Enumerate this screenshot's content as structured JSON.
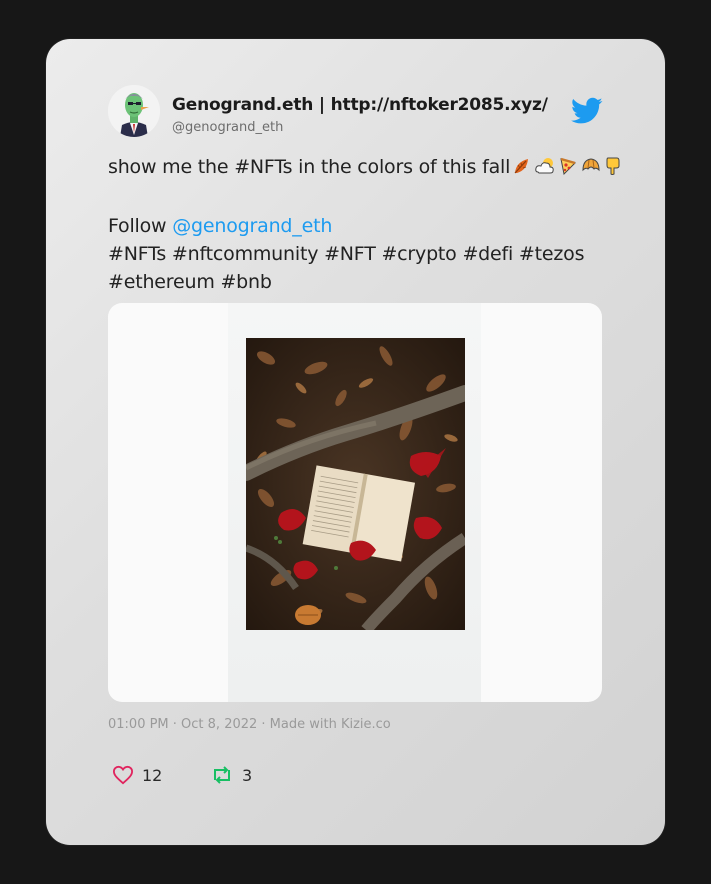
{
  "tweet": {
    "display_name": "Genogrand.eth | http://nftoker2085.xyz/",
    "handle": "@genogrand_eth",
    "text_line1": "show me the #NFTs in the colors of this fall",
    "follow_word": "Follow ",
    "follow_mention": "@genogrand_eth",
    "hashtags_line1": "#NFTs #nftcommunity #NFT #crypto #defi #tezos",
    "hashtags_line2": "#ethereum #bnb",
    "meta": "01:00 PM · Oct 8, 2022 · Made with Kizie.co",
    "likes": "12",
    "retweets": "3"
  },
  "icons": {
    "avatar": "nft-avatar",
    "brand": "twitter-bird-icon",
    "like": "heart-icon",
    "retweet": "retweet-icon",
    "emojis": [
      "fallen-leaf-icon",
      "sun-behind-cloud-icon",
      "pizza-icon",
      "croissant-icon",
      "backhand-index-pointing-down-icon"
    ]
  },
  "colors": {
    "background": "#171717",
    "card": "#e2e2e2",
    "twitter_blue": "#1d9bf0",
    "like_red": "#e0245e",
    "retweet_green": "#17bf63"
  }
}
